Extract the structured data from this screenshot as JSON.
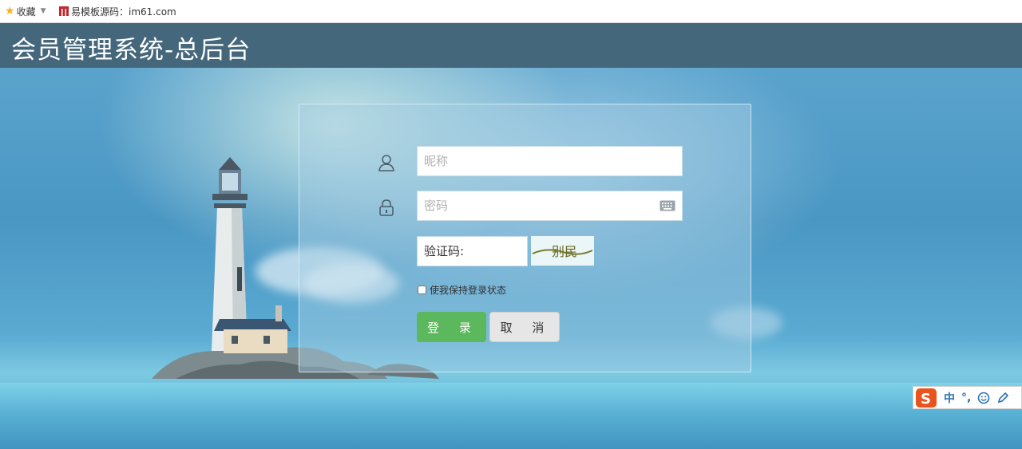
{
  "bookmark_bar": {
    "favorites_label": "收藏",
    "site_label": "易模板源码：im61.com"
  },
  "header": {
    "title": "会员管理系统-总后台"
  },
  "login": {
    "username_placeholder": "昵称",
    "password_placeholder": "密码",
    "captcha_label": "验证码:",
    "captcha_text": "别民",
    "remember_label": "使我保持登录状态",
    "login_label": "登 录",
    "cancel_label": "取 消"
  },
  "ime": {
    "lang": "中",
    "punct": "°,"
  },
  "colors": {
    "header_bg": "#44677c",
    "login_button": "#5cb85c",
    "cancel_button": "#e6e6e6"
  }
}
